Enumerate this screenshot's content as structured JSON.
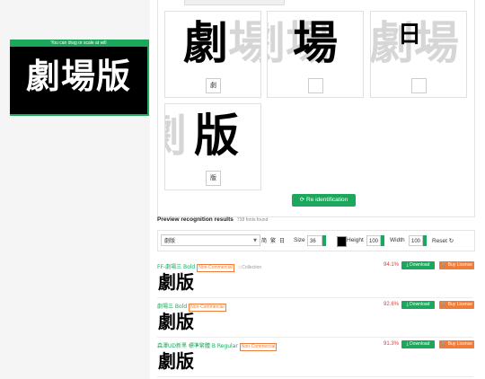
{
  "drag_banner": "You can drag or scale at will",
  "preview_text": "劇場版",
  "segments": [
    {
      "ghost": "劇場",
      "solid": "劇",
      "input": "劇"
    },
    {
      "ghost": "劇場",
      "solid": "場",
      "input": ""
    },
    {
      "ghost": "劇場",
      "solid": "日",
      "input": ""
    },
    {
      "ghost": "劇",
      "solid": "版",
      "input": "版"
    }
  ],
  "reidentify_label": "Re identification",
  "results": {
    "title": "Preview recognition results",
    "count": "738 fonts found"
  },
  "toolbar": {
    "text_value": "劇版",
    "mode_simplified": "简",
    "mode_traditional": "繁",
    "mode_japanese": "日",
    "size_label": "Size",
    "size_value": "36",
    "height_label": "Height",
    "height_value": "100",
    "width_label": "Width",
    "width_value": "100",
    "reset_label": "Reset",
    "reset_icon": "↻"
  },
  "fonts": [
    {
      "name": "FF-劇場三 Bold",
      "tag": "Non-Commercial",
      "collection": "Collection",
      "score": "94.1%",
      "sample": "劇版"
    },
    {
      "name": "劇場三 Bold",
      "tag": "Non-Commercial",
      "collection": "",
      "score": "92.6%",
      "sample": "劇版"
    },
    {
      "name": "森澤UD新黑 標準繁體 B Regular",
      "tag": "Non-Commercial",
      "collection": "",
      "score": "91.3%",
      "sample": "劇版"
    }
  ],
  "buttons": {
    "download": "Download",
    "buy": "Buy License"
  },
  "colors": {
    "accent": "#1ba85c",
    "buy": "#f07c3a",
    "score": "#e53935"
  }
}
